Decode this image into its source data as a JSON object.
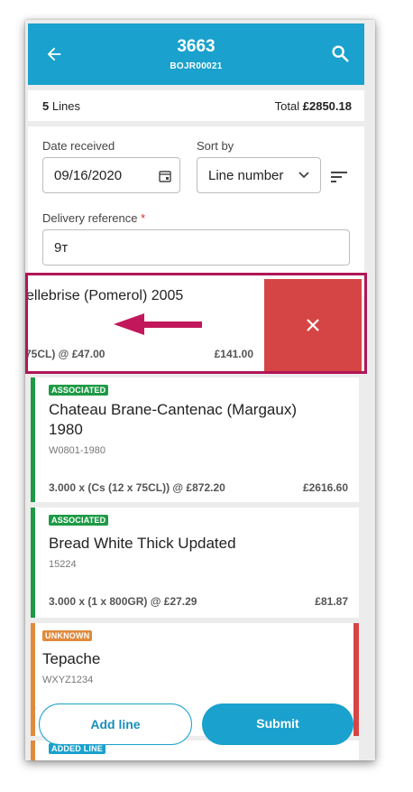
{
  "header": {
    "title": "3663",
    "subtitle": "BOJR00021"
  },
  "summary": {
    "lines_count": "5",
    "lines_label": "Lines",
    "total_label": "Total",
    "total_value": "£2850.18"
  },
  "form": {
    "date_label": "Date received",
    "date_value": "09/16/2020",
    "sort_label": "Sort by",
    "sort_value": "Line number",
    "reference_label": "Delivery reference",
    "reference_required_mark": "*",
    "reference_value": "9т"
  },
  "swiped_line": {
    "name": "ellebrise (Pomerol) 2005",
    "qty": "75CL) @ £47.00",
    "amount": "£141.00"
  },
  "lines": [
    {
      "badge": "ASSOCIATED",
      "name": "Chateau Brane-Cantenac (Margaux) 1980",
      "code": "W0801-1980",
      "qty": "3.000 x (Cs (12 x 75CL)) @ £872.20",
      "amount": "£2616.60"
    },
    {
      "badge": "ASSOCIATED",
      "name": "Bread White Thick Updated",
      "code": "15224",
      "qty": "3.000 x (1 x 800GR) @ £27.29",
      "amount": "£81.87"
    },
    {
      "badge": "UNKNOWN",
      "name": "Tepache",
      "code": "WXYZ1234"
    },
    {
      "badge": "ADDED LINE"
    }
  ],
  "actions": {
    "add_line": "Add line",
    "submit": "Submit"
  },
  "colors": {
    "header": "#1aa1cd",
    "associated": "#1e9a46",
    "unknown": "#e08a3c",
    "delete": "#d64545",
    "highlight": "#b01657"
  }
}
